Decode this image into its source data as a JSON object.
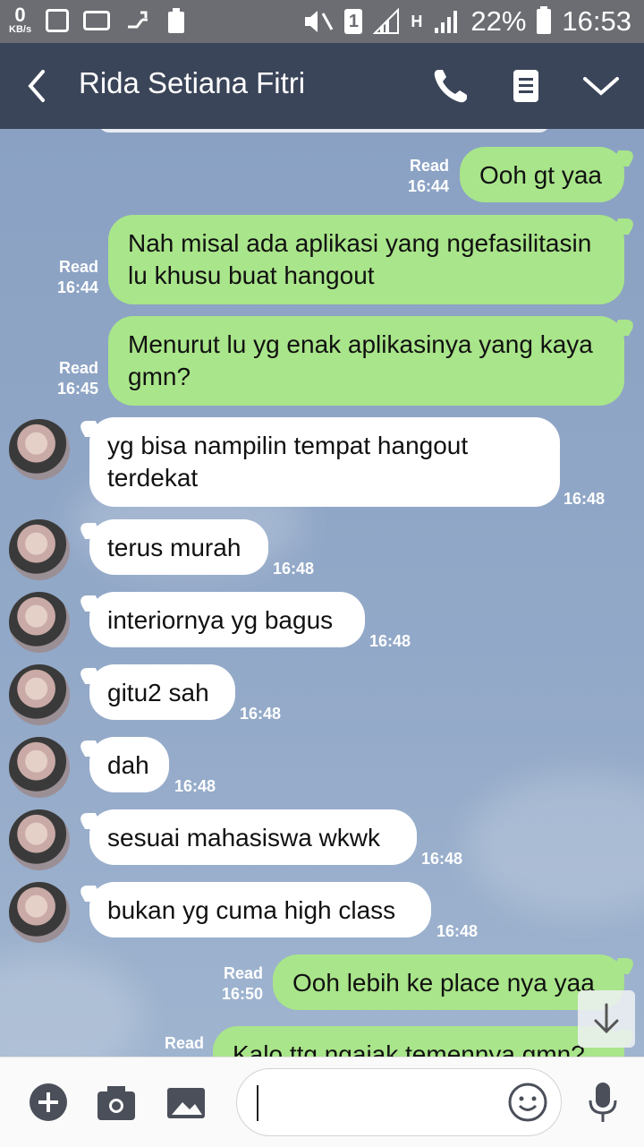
{
  "status_bar": {
    "net_speed": "0",
    "net_unit": "KB/s",
    "sim_slot": "1",
    "net_type": "H",
    "battery": "22%",
    "time": "16:53"
  },
  "header": {
    "title": "Rida Setiana Fitri"
  },
  "messages": [
    {
      "dir": "out",
      "text": "Ooh gt yaa",
      "read": "Read",
      "time": "16:44"
    },
    {
      "dir": "out",
      "text": "Nah misal ada aplikasi yang ngefasilitasin lu khusu buat hangout",
      "read": "Read",
      "time": "16:44"
    },
    {
      "dir": "out",
      "text": "Menurut lu yg enak aplikasinya yang kaya gmn?",
      "read": "Read",
      "time": "16:45"
    },
    {
      "dir": "in",
      "text": "yg bisa nampilin tempat hangout terdekat",
      "time": "16:48"
    },
    {
      "dir": "in",
      "text": "terus murah",
      "time": "16:48"
    },
    {
      "dir": "in",
      "text": "interiornya yg bagus",
      "time": "16:48"
    },
    {
      "dir": "in",
      "text": "gitu2 sah",
      "time": "16:48"
    },
    {
      "dir": "in",
      "text": "dah",
      "time": "16:48"
    },
    {
      "dir": "in",
      "text": "sesuai mahasiswa wkwk",
      "time": "16:48"
    },
    {
      "dir": "in",
      "text": "bukan yg cuma high class",
      "time": "16:48"
    },
    {
      "dir": "out",
      "text": "Ooh lebih ke place nya yaa",
      "read": "Read",
      "time": "16:50"
    },
    {
      "dir": "out",
      "text": "Kalo ttg ngajak temennya gmn?",
      "read": "Read",
      "time": ""
    }
  ],
  "input": {
    "value": ""
  },
  "colors": {
    "header_bg": "#3b4559",
    "outgoing_bubble": "#a9e58a",
    "incoming_bubble": "#ffffff",
    "status_bar_bg": "#6b6d72"
  },
  "icons": [
    "back-chevron-icon",
    "phone-icon",
    "notes-icon",
    "chevron-down-icon",
    "plus-icon",
    "camera-icon",
    "image-icon",
    "emoji-icon",
    "microphone-icon",
    "arrow-down-icon"
  ]
}
